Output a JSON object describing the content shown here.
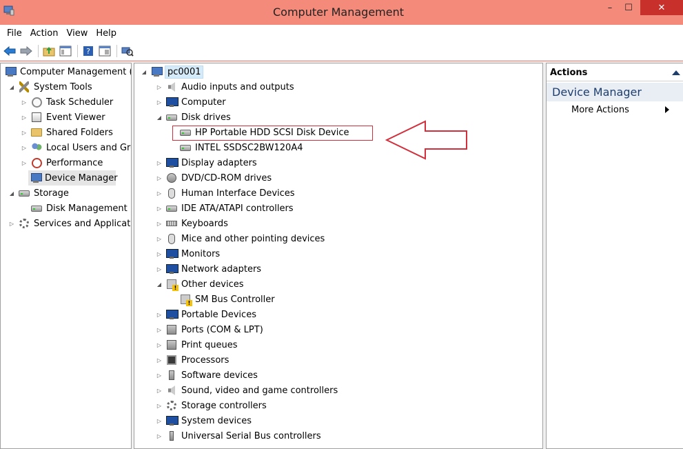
{
  "window": {
    "title": "Computer Management",
    "minimize": "–",
    "maximize": "☐",
    "close": "✕"
  },
  "menu": [
    "File",
    "Action",
    "View",
    "Help"
  ],
  "toolbar_icons": [
    "back-arrow-icon",
    "forward-arrow-icon",
    "up-folder-icon",
    "show-hide-tree-icon",
    "help-icon",
    "properties-icon",
    "scan-hardware-icon"
  ],
  "left_tree": [
    {
      "label": "Computer Management (L",
      "icon": "computer-management-icon",
      "expander": "",
      "level": 0
    },
    {
      "label": "System Tools",
      "icon": "tools-icon",
      "expander": "◢",
      "level": 1
    },
    {
      "label": "Task Scheduler",
      "icon": "clock-icon",
      "expander": "▷",
      "level": 2
    },
    {
      "label": "Event Viewer",
      "icon": "event-viewer-icon",
      "expander": "▷",
      "level": 2
    },
    {
      "label": "Shared Folders",
      "icon": "shared-folder-icon",
      "expander": "▷",
      "level": 2
    },
    {
      "label": "Local Users and Gro",
      "icon": "users-icon",
      "expander": "▷",
      "level": 2
    },
    {
      "label": "Performance",
      "icon": "performance-icon",
      "expander": "▷",
      "level": 2
    },
    {
      "label": "Device Manager",
      "icon": "device-manager-icon",
      "expander": "",
      "level": 2,
      "selected": true
    },
    {
      "label": "Storage",
      "icon": "storage-icon",
      "expander": "◢",
      "level": 1
    },
    {
      "label": "Disk Management",
      "icon": "disk-management-icon",
      "expander": "",
      "level": 2
    },
    {
      "label": "Services and Application",
      "icon": "services-icon",
      "expander": "▷",
      "level": 1
    }
  ],
  "device_tree": {
    "root": "pc0001",
    "items": [
      {
        "label": "Audio inputs and outputs",
        "icon": "speaker-icon",
        "expander": "▷",
        "level": 1
      },
      {
        "label": "Computer",
        "icon": "computer-icon",
        "expander": "▷",
        "level": 1
      },
      {
        "label": "Disk drives",
        "icon": "disk-drive-icon",
        "expander": "◢",
        "level": 1
      },
      {
        "label": "HP Portable HDD SCSI Disk Device",
        "icon": "disk-drive-icon",
        "expander": "",
        "level": 2,
        "highlighted": true
      },
      {
        "label": "INTEL SSDSC2BW120A4",
        "icon": "disk-drive-icon",
        "expander": "",
        "level": 2
      },
      {
        "label": "Display adapters",
        "icon": "display-adapter-icon",
        "expander": "▷",
        "level": 1
      },
      {
        "label": "DVD/CD-ROM drives",
        "icon": "dvd-drive-icon",
        "expander": "▷",
        "level": 1
      },
      {
        "label": "Human Interface Devices",
        "icon": "hid-icon",
        "expander": "▷",
        "level": 1
      },
      {
        "label": "IDE ATA/ATAPI controllers",
        "icon": "ide-controller-icon",
        "expander": "▷",
        "level": 1
      },
      {
        "label": "Keyboards",
        "icon": "keyboard-icon",
        "expander": "▷",
        "level": 1
      },
      {
        "label": "Mice and other pointing devices",
        "icon": "mouse-icon",
        "expander": "▷",
        "level": 1
      },
      {
        "label": "Monitors",
        "icon": "monitor-icon",
        "expander": "▷",
        "level": 1
      },
      {
        "label": "Network adapters",
        "icon": "network-adapter-icon",
        "expander": "▷",
        "level": 1
      },
      {
        "label": "Other devices",
        "icon": "other-devices-icon",
        "expander": "◢",
        "level": 1
      },
      {
        "label": "SM Bus Controller",
        "icon": "warning-device-icon",
        "expander": "",
        "level": 2
      },
      {
        "label": "Portable Devices",
        "icon": "portable-device-icon",
        "expander": "▷",
        "level": 1
      },
      {
        "label": "Ports (COM & LPT)",
        "icon": "port-icon",
        "expander": "▷",
        "level": 1
      },
      {
        "label": "Print queues",
        "icon": "printer-icon",
        "expander": "▷",
        "level": 1
      },
      {
        "label": "Processors",
        "icon": "processor-icon",
        "expander": "▷",
        "level": 1
      },
      {
        "label": "Software devices",
        "icon": "software-device-icon",
        "expander": "▷",
        "level": 1
      },
      {
        "label": "Sound, video and game controllers",
        "icon": "sound-icon",
        "expander": "▷",
        "level": 1
      },
      {
        "label": "Storage controllers",
        "icon": "storage-controller-icon",
        "expander": "▷",
        "level": 1
      },
      {
        "label": "System devices",
        "icon": "system-device-icon",
        "expander": "▷",
        "level": 1
      },
      {
        "label": "Universal Serial Bus controllers",
        "icon": "usb-icon",
        "expander": "▷",
        "level": 1
      }
    ]
  },
  "actions_pane": {
    "header": "Actions",
    "section": "Device Manager",
    "more_actions": "More Actions"
  },
  "colors": {
    "title_bar": "#f48a7a",
    "close_button": "#c7302b",
    "annotation": "#d12f3b"
  }
}
